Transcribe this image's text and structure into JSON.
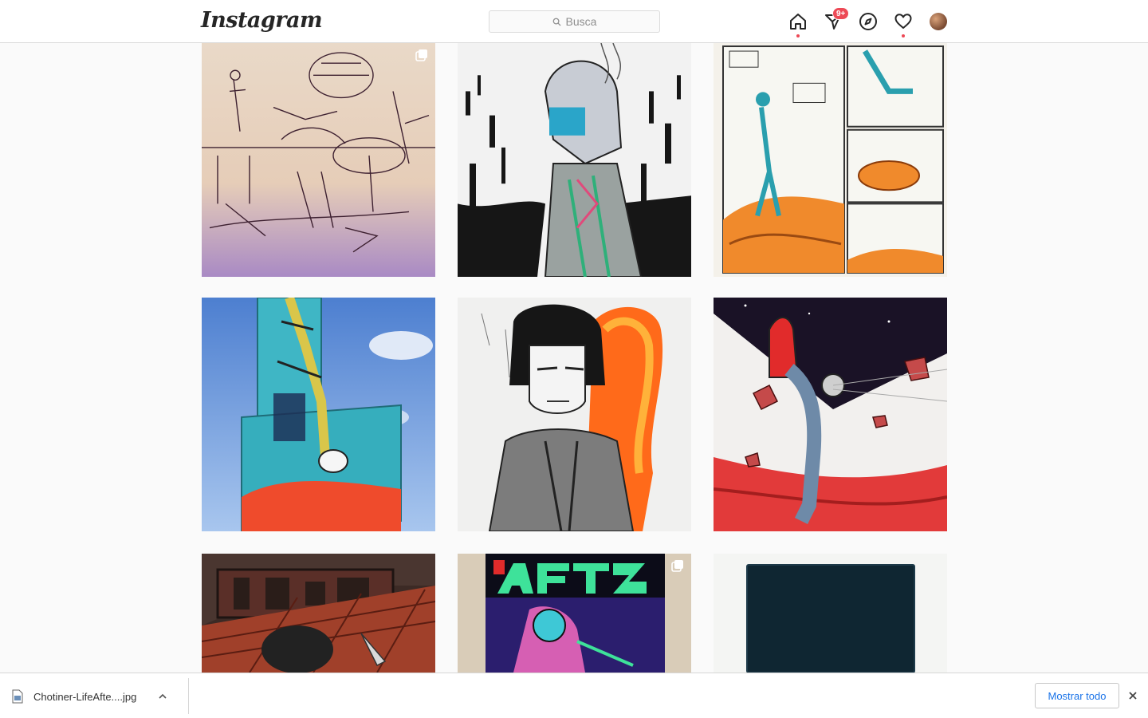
{
  "header": {
    "logo_text": "Instagram",
    "search_placeholder": "Busca",
    "activity_badge": "9+"
  },
  "nav_icons": [
    "home-icon",
    "direct-icon",
    "explore-icon",
    "activity-heart-icon",
    "profile-avatar"
  ],
  "posts": [
    {
      "id": 1,
      "subject": "sketch beach scene",
      "multi": true
    },
    {
      "id": 2,
      "subject": "cyborg profile ink",
      "multi": false
    },
    {
      "id": 3,
      "subject": "comic page asteroid",
      "multi": false
    },
    {
      "id": 4,
      "subject": "container tower mural",
      "multi": false
    },
    {
      "id": 5,
      "subject": "girl portrait orange",
      "multi": false
    },
    {
      "id": 6,
      "subject": "astronaut red planet",
      "multi": false
    },
    {
      "id": 7,
      "subject": "toolbox knife",
      "multi": false
    },
    {
      "id": 8,
      "subject": "after paradise comic cover",
      "multi": true
    },
    {
      "id": 9,
      "subject": "dark book cover",
      "multi": false
    }
  ],
  "download_bar": {
    "file_name": "Chotiner-LifeAfte....jpg",
    "show_all_label": "Mostrar todo"
  },
  "colors": {
    "accent_red": "#ed4956",
    "link_blue": "#1a73e8"
  }
}
